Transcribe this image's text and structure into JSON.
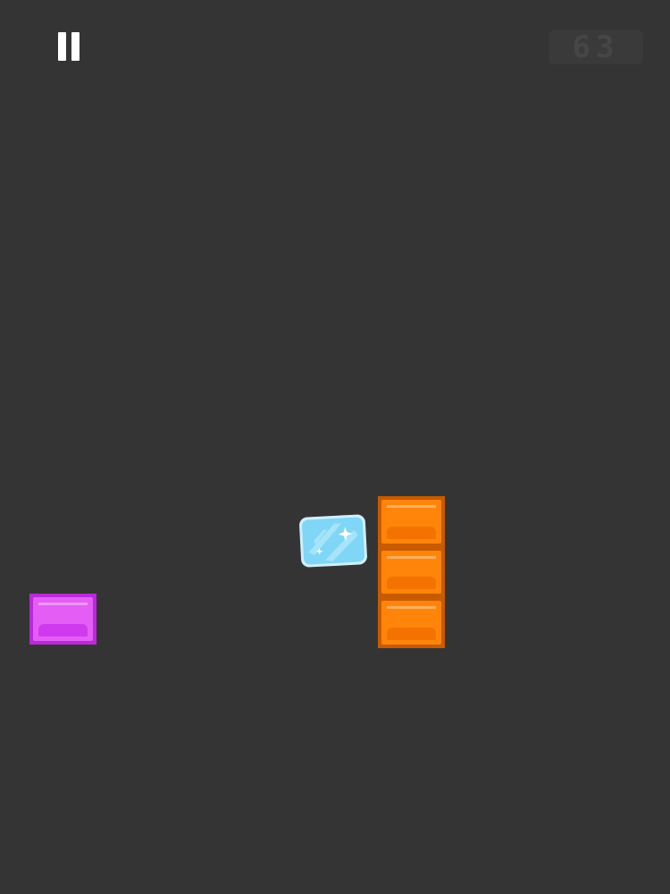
{
  "game": {
    "background_color": "#353435",
    "score": "63",
    "pause_icon": "pause-icon",
    "colors": {
      "pause": "#ffffff",
      "score_bg": "#3b3a3b",
      "score_text": "#474647",
      "magenta_border": "#b92ad8",
      "magenta_fill": "#e45ef5",
      "magenta_shade": "#d03aee",
      "orange_border": "#c85a00",
      "orange_fill": "#ff850a",
      "orange_shade": "#f47300",
      "ice_fill": "#7fd6f7",
      "ice_border": "#cfeffc",
      "ice_stripe": "#b6e9fb"
    }
  },
  "blocks": [
    {
      "kind": "magenta-block",
      "color": "magenta"
    },
    {
      "kind": "orange-block",
      "color": "orange"
    },
    {
      "kind": "orange-block",
      "color": "orange"
    },
    {
      "kind": "orange-block",
      "color": "orange"
    }
  ],
  "player": {
    "kind": "ice-block"
  }
}
